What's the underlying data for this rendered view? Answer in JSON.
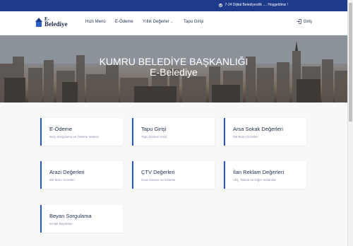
{
  "topbar": {
    "notice": "7-24 Dijital Belediyecilik .... Hoşgeldiniz !"
  },
  "logo": {
    "line1": "E-",
    "line2": "Belediye"
  },
  "nav": {
    "items": [
      {
        "label": "Hızlı Menü"
      },
      {
        "label": "E-Ödeme"
      },
      {
        "label": "Yıllık Değerler"
      },
      {
        "label": "Tapu Girişi"
      }
    ],
    "login": "Giriş"
  },
  "hero": {
    "title_line1": "KUMRU BELEDİYE BAŞKANLIĞI",
    "title_line2": "E-Belediye"
  },
  "cards": [
    {
      "title": "E-Ödeme",
      "subtitle": "Borç Sorgulama ve Ödeme Sistemi"
    },
    {
      "title": "Tapu Girişi",
      "subtitle": "Tapu Dairesi Girişi"
    },
    {
      "title": "Arsa Sokak Değerleri",
      "subtitle": "M2 Birim Ücretleri"
    },
    {
      "title": "Arazi Değerleri",
      "subtitle": "M2 Birim Ücretleri"
    },
    {
      "title": "ÇTV Değerleri",
      "subtitle": "Grup Derece ve Kriterler"
    },
    {
      "title": "İlan Reklam Değerleri",
      "subtitle": "Afiş, Tabela ve Diğer reklamlar"
    },
    {
      "title": "Beyan Sorgulama",
      "subtitle": "Emlak Beyanları"
    }
  ],
  "colors": {
    "topbar": "#1e3a8a",
    "accent": "#2756c8",
    "text": "#1f2d4e",
    "muted": "#8a93a6"
  }
}
